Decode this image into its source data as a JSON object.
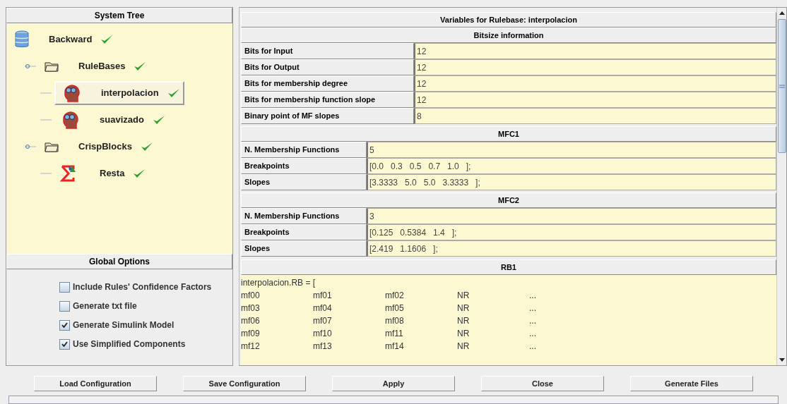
{
  "system_tree": {
    "title": "System Tree",
    "items": [
      {
        "kind": "database",
        "label": "Backward",
        "valid": true,
        "selected": false,
        "children": [
          {
            "kind": "folder",
            "label": "RuleBases",
            "valid": true,
            "selected": false,
            "expanded": true,
            "children": [
              {
                "kind": "rulebase",
                "label": "interpolacion",
                "valid": true,
                "selected": true
              },
              {
                "kind": "rulebase",
                "label": "suavizado",
                "valid": true,
                "selected": false
              }
            ]
          },
          {
            "kind": "folder",
            "label": "CrispBlocks",
            "valid": true,
            "selected": false,
            "expanded": true,
            "children": [
              {
                "kind": "crisp",
                "label": "Resta",
                "valid": true,
                "selected": false
              }
            ]
          }
        ]
      }
    ]
  },
  "global_options": {
    "title": "Global Options",
    "options": [
      {
        "label": "Include Rules' Confidence Factors",
        "checked": false
      },
      {
        "label": "Generate txt file",
        "checked": false
      },
      {
        "label": "Generate Simulink Model",
        "checked": true
      },
      {
        "label": "Use Simplified Components",
        "checked": true
      }
    ]
  },
  "variables": {
    "title": "Variables for Rulebase: interpolacion",
    "sections": [
      {
        "title": "Bitsize information",
        "wide_labels": true,
        "rows": [
          {
            "label": "Bits for Input",
            "value": "12"
          },
          {
            "label": "Bits for Output",
            "value": "12"
          },
          {
            "label": "Bits for membership degree",
            "value": "12"
          },
          {
            "label": "Bits for membership function slope",
            "value": "12"
          },
          {
            "label": "Binary point of MF slopes",
            "value": "8"
          }
        ]
      },
      {
        "title": "MFC1",
        "wide_labels": false,
        "rows": [
          {
            "label": "N. Membership Functions",
            "value": "5"
          },
          {
            "label": "Breakpoints",
            "value": "[0.0   0.3   0.5   0.7   1.0   ];"
          },
          {
            "label": "Slopes",
            "value": "[3.3333   5.0   5.0   3.3333   ];"
          }
        ]
      },
      {
        "title": "MFC2",
        "wide_labels": false,
        "rows": [
          {
            "label": "N. Membership Functions",
            "value": "3"
          },
          {
            "label": "Breakpoints",
            "value": "[0.125   0.5384   1.4   ];"
          },
          {
            "label": "Slopes",
            "value": "[2.419   1.1606   ];"
          }
        ]
      }
    ],
    "rules": {
      "title": "RB1",
      "header": "interpolacion.RB = [",
      "lines": [
        [
          "mf00",
          "mf01",
          "mf02",
          "NR",
          "..."
        ],
        [
          "mf03",
          "mf04",
          "mf05",
          "NR",
          "..."
        ],
        [
          "mf06",
          "mf07",
          "mf08",
          "NR",
          "..."
        ],
        [
          "mf09",
          "mf10",
          "mf11",
          "NR",
          "..."
        ],
        [
          "mf12",
          "mf13",
          "mf14",
          "NR",
          "..."
        ]
      ]
    }
  },
  "buttons": [
    "Load Configuration",
    "Save Configuration",
    "Apply",
    "Close",
    "Generate Files"
  ]
}
